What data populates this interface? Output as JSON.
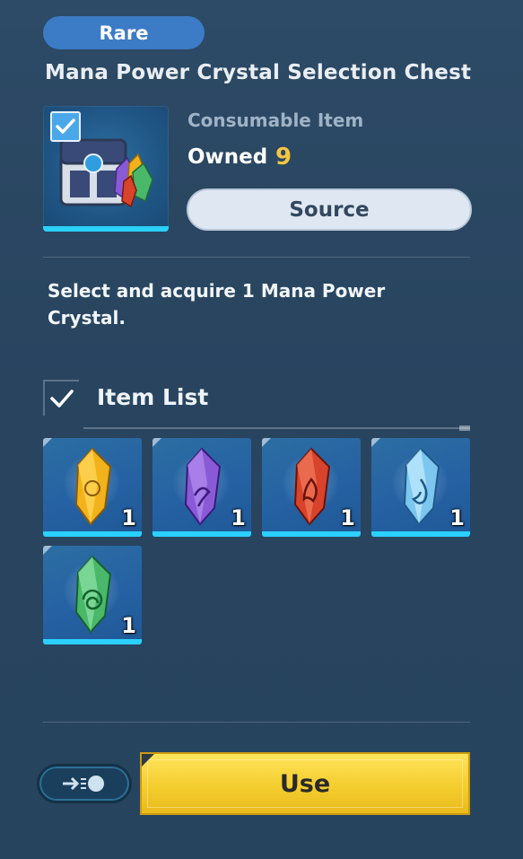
{
  "header": {
    "rarity": "Rare",
    "title": "Mana Power Crystal Selection Chest"
  },
  "item": {
    "type": "Consumable Item",
    "owned_label": "Owned",
    "owned_count": "9",
    "source_label": "Source",
    "icon": "selection-chest-icon",
    "selected": true
  },
  "description": "Select and acquire 1 Mana Power Crystal.",
  "item_list": {
    "title": "Item List",
    "items": [
      {
        "name": "yellow-crystal",
        "quantity": "1",
        "color": "#f2b21b"
      },
      {
        "name": "purple-crystal",
        "quantity": "1",
        "color": "#8a5ad6"
      },
      {
        "name": "red-crystal",
        "quantity": "1",
        "color": "#d8432c"
      },
      {
        "name": "blue-crystal",
        "quantity": "1",
        "color": "#7cc6ef"
      },
      {
        "name": "green-crystal",
        "quantity": "1",
        "color": "#49b869"
      }
    ]
  },
  "actions": {
    "use_label": "Use",
    "toggle_icon": "skip-arrow-icon"
  },
  "colors": {
    "accent": "#2ad0ff",
    "rarity_badge": "#3c7bc6",
    "use_button": "#f4cd2f",
    "owned_count": "#f7c542"
  }
}
